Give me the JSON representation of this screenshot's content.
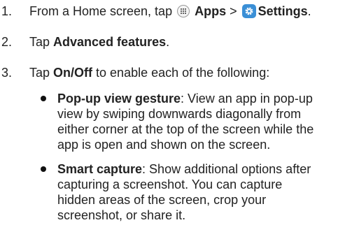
{
  "steps": [
    {
      "number": "1.",
      "prefix": "From a Home screen, tap ",
      "apps_label": "Apps",
      "separator": " > ",
      "settings_label": "Settings",
      "suffix": "."
    },
    {
      "number": "2.",
      "prefix": "Tap ",
      "bold": "Advanced features",
      "suffix": "."
    },
    {
      "number": "3.",
      "prefix": "Tap ",
      "bold": "On/Off",
      "suffix": " to enable each of the following:"
    }
  ],
  "bullets": [
    {
      "title": "Pop-up view gesture",
      "lines": [
        ": View an app in pop-up",
        "view by swiping downwards diagonally from",
        "either corner at the top of the screen while the",
        "app is open and shown on the screen."
      ]
    },
    {
      "title": "Smart capture",
      "lines": [
        ": Show additional options after",
        "capturing a screenshot. You can capture",
        "hidden areas of the screen, crop your",
        "screenshot, or share it."
      ]
    }
  ],
  "icons": {
    "apps": "apps-grid-icon",
    "settings": "gear-icon",
    "settings_color": "#3a8fd6"
  }
}
